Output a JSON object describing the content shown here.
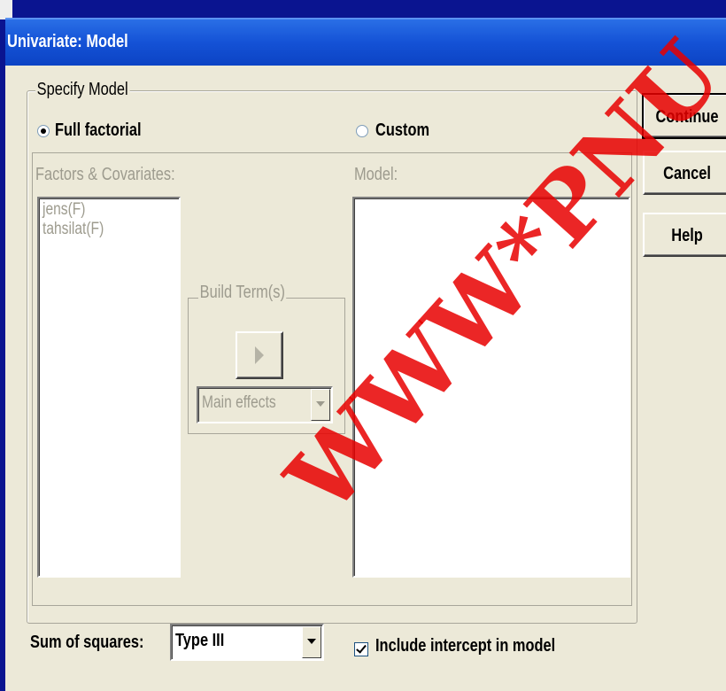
{
  "window": {
    "title": "Univariate: Model"
  },
  "specify_model": {
    "legend": "Specify Model",
    "full_factorial_label": "Full factorial",
    "custom_label": "Custom",
    "selected": "Full factorial"
  },
  "factors": {
    "label": "Factors & Covariates:",
    "items": [
      "jens(F)",
      "tahsilat(F)"
    ]
  },
  "model": {
    "label": "Model:",
    "items": []
  },
  "build_terms": {
    "legend": "Build Term(s)",
    "type_value": "Main effects",
    "enabled": false
  },
  "buttons": {
    "continue": "Continue",
    "cancel": "Cancel",
    "help": "Help"
  },
  "sum_of_squares": {
    "label": "Sum of squares:",
    "value": "Type III"
  },
  "include_intercept": {
    "label": "Include intercept in model",
    "checked": true
  },
  "watermark": {
    "text": "WWW*PNU"
  },
  "colors": {
    "title_bar": "#1452d6",
    "dialog_bg": "#ece9d8",
    "background": "#0a1490",
    "watermark": "#e80000",
    "disabled_text": "#9d9b8e"
  }
}
